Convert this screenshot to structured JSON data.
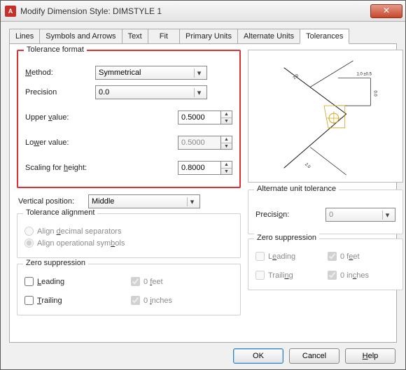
{
  "window": {
    "title": "Modify Dimension Style: DIMSTYLE 1",
    "icon_letter": "A"
  },
  "tabs": {
    "items": [
      {
        "label": "Lines"
      },
      {
        "label": "Symbols and Arrows"
      },
      {
        "label": "Text"
      },
      {
        "label": "Fit"
      },
      {
        "label": "Primary Units"
      },
      {
        "label": "Alternate Units"
      },
      {
        "label": "Tolerances"
      }
    ],
    "active_index": 6
  },
  "tolerance_format": {
    "legend": "Tolerance format",
    "method_label": "Method:",
    "method_value": "Symmetrical",
    "precision_label": "Precision",
    "precision_value": "0.0",
    "upper_label": "Upper value:",
    "upper_value": "0.5000",
    "lower_label": "Lower value:",
    "lower_value": "0.5000",
    "lower_enabled": false,
    "scaling_label": "Scaling for height:",
    "scaling_value": "0.8000"
  },
  "vertical_position": {
    "label": "Vertical position:",
    "value": "Middle"
  },
  "tolerance_alignment": {
    "legend": "Tolerance alignment",
    "opt_decimal": "Align decimal separators",
    "opt_operational": "Align operational symbols",
    "selected": "operational",
    "enabled": false
  },
  "zero_suppression": {
    "legend": "Zero suppression",
    "leading_label": "Leading",
    "leading_checked": false,
    "trailing_label": "Trailing",
    "trailing_checked": false,
    "feet_label": "0 feet",
    "feet_checked": true,
    "feet_enabled": false,
    "inches_label": "0 inches",
    "inches_checked": true,
    "inches_enabled": false
  },
  "alternate_unit_tolerance": {
    "legend": "Alternate unit tolerance",
    "precision_label": "Precision:",
    "precision_value": "0",
    "enabled": false
  },
  "alt_zero_suppression": {
    "legend": "Zero suppression",
    "leading_label": "Leading",
    "leading_checked": false,
    "leading_enabled": false,
    "trailing_label": "Trailing",
    "trailing_checked": false,
    "trailing_enabled": false,
    "feet_label": "0 feet",
    "feet_checked": true,
    "feet_enabled": false,
    "inches_label": "0 inches",
    "inches_checked": true,
    "inches_enabled": false
  },
  "buttons": {
    "ok": "OK",
    "cancel": "Cancel",
    "help": "Help"
  }
}
